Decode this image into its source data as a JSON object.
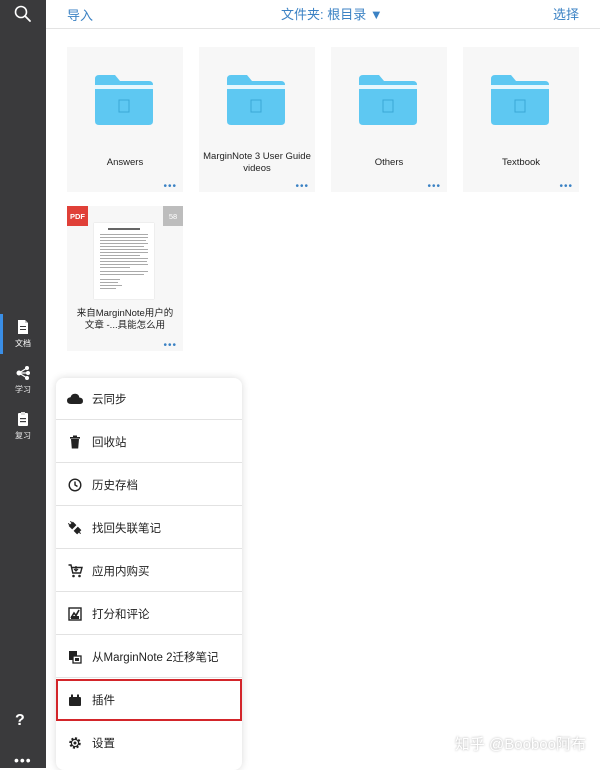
{
  "topbar": {
    "import_label": "导入",
    "folder_label": "文件夹: 根目录 ▼",
    "select_label": "选择"
  },
  "sidebar": {
    "items": [
      {
        "label": "文档",
        "icon": "document-icon",
        "active": true
      },
      {
        "label": "学习",
        "icon": "mindmap-icon",
        "active": false
      },
      {
        "label": "复习",
        "icon": "clipboard-icon",
        "active": false
      }
    ],
    "help_label": "?",
    "more_label": "•••"
  },
  "folders": [
    {
      "name": "Answers"
    },
    {
      "name": "MarginNote 3 User Guide videos"
    },
    {
      "name": "Others"
    },
    {
      "name": "Textbook"
    }
  ],
  "document": {
    "type_badge": "PDF",
    "page_count": "58",
    "name": "来自MarginNote用户的文章 -...具能怎么用"
  },
  "more_dots": "•••",
  "menu": {
    "items": [
      {
        "label": "云同步",
        "icon": "cloud-icon"
      },
      {
        "label": "回收站",
        "icon": "trash-icon"
      },
      {
        "label": "历史存档",
        "icon": "history-icon"
      },
      {
        "label": "找回失联笔记",
        "icon": "plug-icon"
      },
      {
        "label": "应用内购买",
        "icon": "cart-icon"
      },
      {
        "label": "打分和评论",
        "icon": "rating-icon"
      },
      {
        "label": "从MarginNote 2迁移笔记",
        "icon": "migrate-icon"
      },
      {
        "label": "插件",
        "icon": "plugin-icon",
        "highlighted": true
      },
      {
        "label": "设置",
        "icon": "settings-icon"
      }
    ]
  },
  "watermark": "知乎 @Booboo阿布",
  "colors": {
    "sidebar_bg": "#3a3a3c",
    "accent": "#3b82c4",
    "folder": "#5ec8f2",
    "highlight": "#d3252a"
  }
}
